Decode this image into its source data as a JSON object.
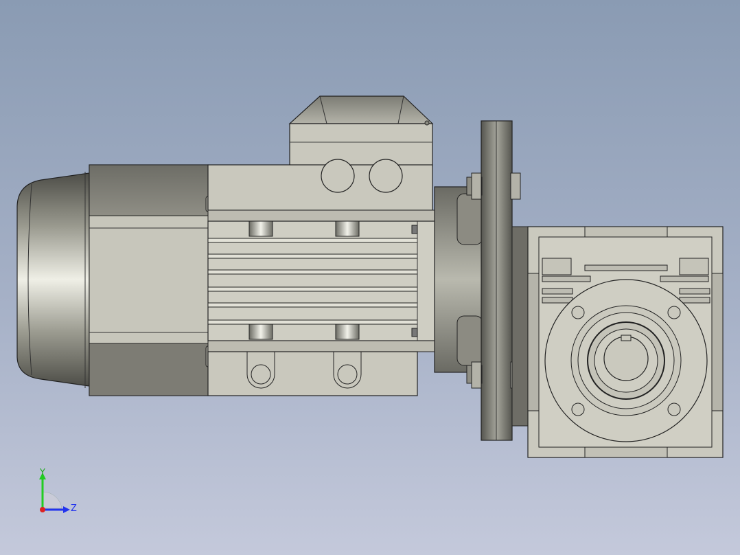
{
  "viewport": {
    "background_top": "#8a9bb3",
    "background_bottom": "#c4c9db"
  },
  "model": {
    "name": "worm gear motor",
    "body_color": "#c9c8bd",
    "dark_color": "#8f8e85",
    "outline_color": "#222222"
  },
  "triad": {
    "y_label": "Y",
    "z_label": "Z",
    "y_color": "#22cc22",
    "z_color": "#2233ee",
    "x_color": "#dd2222"
  }
}
